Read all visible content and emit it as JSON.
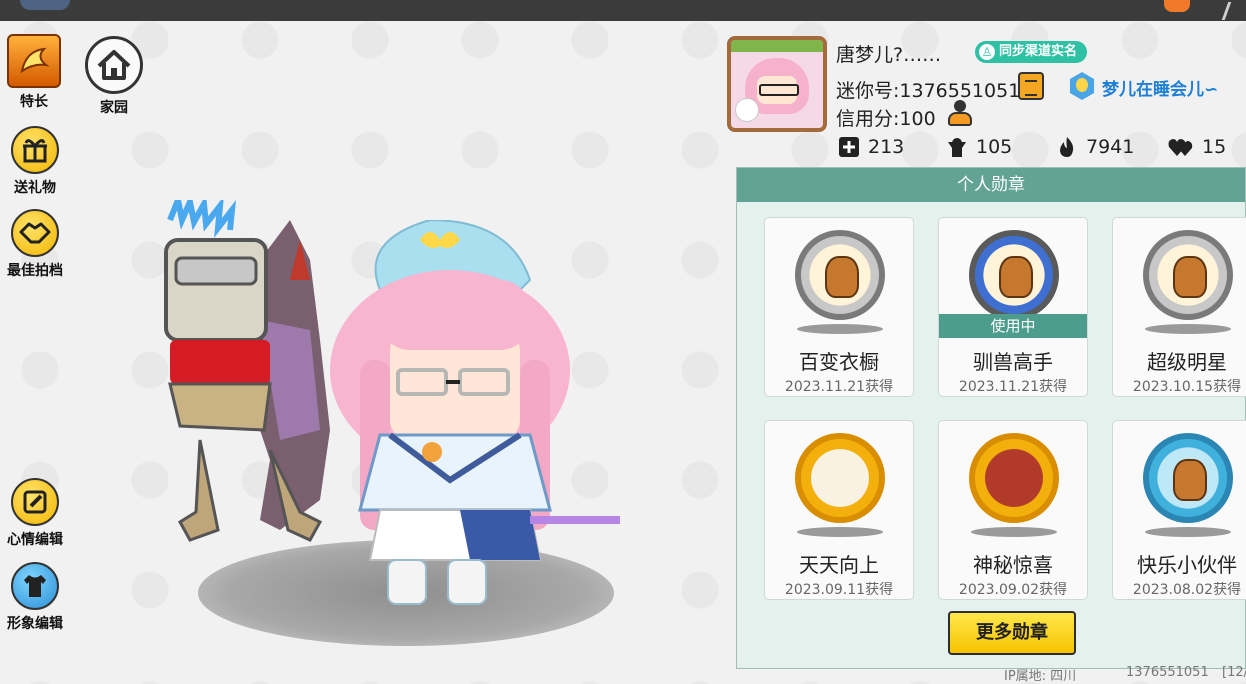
{
  "sidebar": {
    "skill_label": "特长",
    "home_label": "家园",
    "gift_label": "送礼物",
    "photo_label": "最佳拍档",
    "mood_label": "心情编辑",
    "appearance_label": "形象编辑"
  },
  "profile": {
    "name": "唐梦儿?……",
    "sync_badge": "同步渠道实名",
    "mini_id": "迷你号:1376551051",
    "clan_name": "梦儿在睡会儿∽",
    "credit": "信用分:100",
    "stats": {
      "likes": "213",
      "fans": "105",
      "popularity": "7941",
      "hearts": "15"
    }
  },
  "medals": {
    "title": "个人勋章",
    "in_use_label": "使用中",
    "items": [
      {
        "name": "百变衣橱",
        "date": "2023.11.21获得",
        "style": "silver"
      },
      {
        "name": "驯兽高手",
        "date": "2023.11.21获得",
        "style": "blue"
      },
      {
        "name": "超级明星",
        "date": "2023.10.15获得",
        "style": "silver"
      },
      {
        "name": "天天向上",
        "date": "2023.09.11获得",
        "style": "gold"
      },
      {
        "name": "神秘惊喜",
        "date": "2023.09.02获得",
        "style": "goldred"
      },
      {
        "name": "快乐小伙伴",
        "date": "2023.08.02获得",
        "style": "teal"
      }
    ],
    "more_label": "更多勋章"
  },
  "footer": {
    "ip": "IP属地: 四川",
    "uid": "1376551051",
    "bracket": "[12/"
  }
}
